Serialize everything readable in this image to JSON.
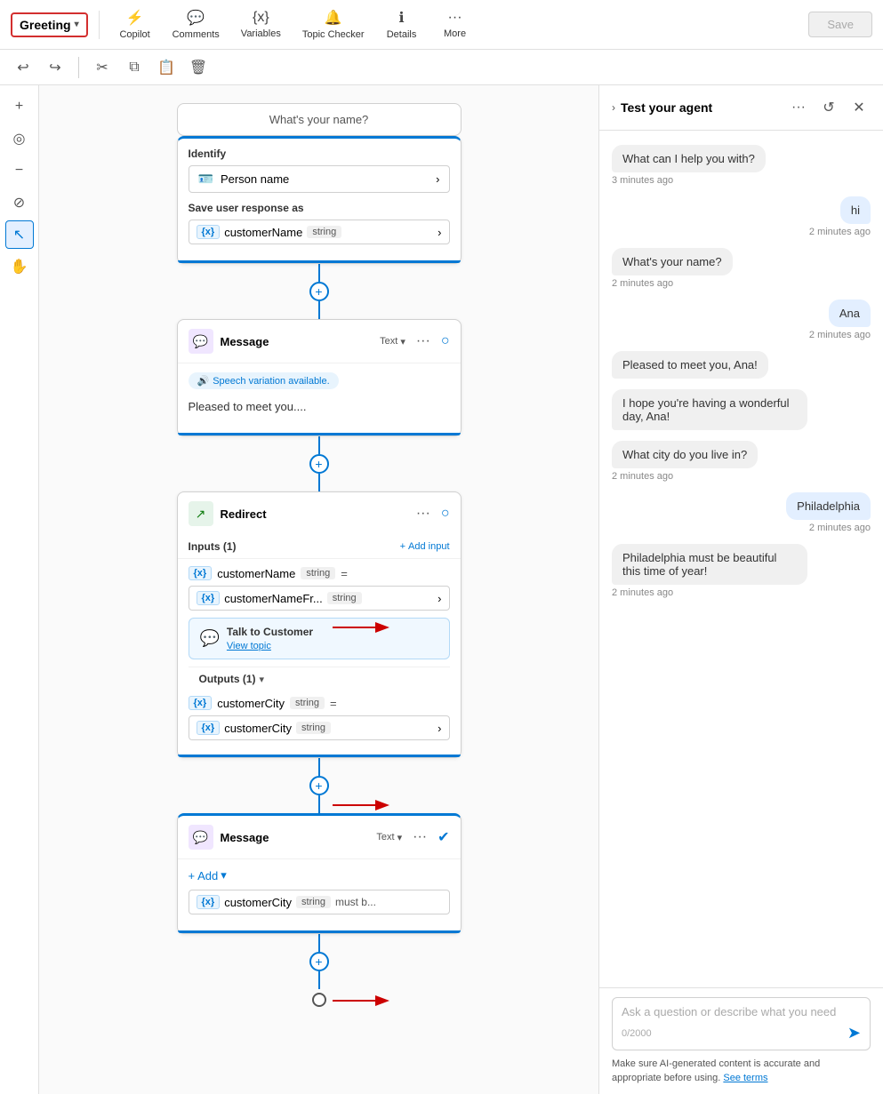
{
  "toolbar": {
    "greeting_label": "Greeting",
    "copilot_label": "Copilot",
    "comments_label": "Comments",
    "variables_label": "Variables",
    "topic_checker_label": "Topic Checker",
    "details_label": "Details",
    "more_label": "More",
    "save_label": "Save"
  },
  "toolbar2": {
    "undo_label": "Undo",
    "redo_label": "Redo",
    "cut_label": "Cut",
    "copy_label": "Copy",
    "paste_label": "Paste",
    "delete_label": "Delete"
  },
  "sidebar": {
    "zoom_in": "zoom-in",
    "target": "target",
    "zoom_out": "zoom-out",
    "ban": "ban",
    "cursor": "cursor",
    "hand": "hand"
  },
  "question_node": {
    "question": "What's your name?",
    "identify_label": "Identify",
    "person_name": "Person name",
    "save_response_label": "Save user response as",
    "var_name": "customerName",
    "var_type": "string"
  },
  "message_node1": {
    "title": "Message",
    "badge": "Text",
    "speech_label": "Speech variation available.",
    "text": "Pleased to meet you...."
  },
  "redirect_node": {
    "title": "Redirect",
    "inputs_label": "Inputs (1)",
    "add_input_label": "Add input",
    "input_var": "customerName",
    "input_type": "string",
    "input_var2": "customerNameFr...",
    "input_type2": "string",
    "talk_title": "Talk to Customer",
    "view_topic_label": "View topic",
    "outputs_label": "Outputs (1)",
    "output_var": "customerCity",
    "output_type": "string",
    "output_var2": "customerCity",
    "output_type2": "string"
  },
  "message_node2": {
    "title": "Message",
    "badge": "Text",
    "add_label": "Add",
    "var_name": "customerCity",
    "var_type": "string",
    "var_suffix": "must b..."
  },
  "chat_panel": {
    "title": "Test your agent",
    "messages": [
      {
        "side": "left",
        "text": "What can I help you with?",
        "time": "3 minutes ago"
      },
      {
        "side": "right",
        "text": "hi",
        "time": "2 minutes ago"
      },
      {
        "side": "left",
        "text": "What's your name?",
        "time": "2 minutes ago"
      },
      {
        "side": "right",
        "text": "Ana",
        "time": "2 minutes ago"
      },
      {
        "side": "left",
        "text": "Pleased to meet you, Ana!",
        "time": null
      },
      {
        "side": "left",
        "text": "I hope you're having a wonderful day, Ana!",
        "time": null
      },
      {
        "side": "left",
        "text": "What city do you live in?",
        "time": "2 minutes ago"
      },
      {
        "side": "right",
        "text": "Philadelphia",
        "time": "2 minutes ago"
      },
      {
        "side": "left",
        "text": "Philadelphia must be beautiful this time of year!",
        "time": "2 minutes ago"
      }
    ],
    "input_placeholder": "Ask a question or describe what you need",
    "char_count": "0/2000",
    "disclaimer": "Make sure AI-generated content is accurate and appropriate before using.",
    "see_terms": "See terms"
  }
}
